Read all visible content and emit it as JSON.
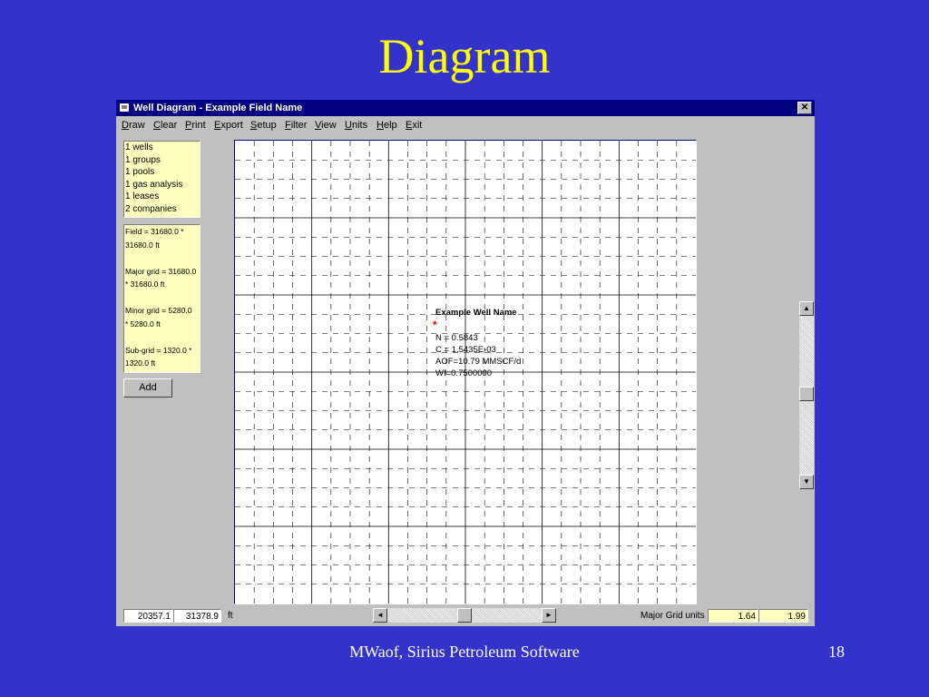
{
  "slide": {
    "title": "Diagram",
    "footer": "MWaof, Sirius Petroleum Software",
    "page_number": "18"
  },
  "window": {
    "title": "Well Diagram - Example Field Name",
    "close_label": "✕"
  },
  "menu": [
    "Draw",
    "Clear",
    "Print",
    "Export",
    "Setup",
    "Filter",
    "View",
    "Units",
    "Help",
    "Exit"
  ],
  "counts": [
    "1 wells",
    "1 groups",
    "1 pools",
    "1 gas analysis",
    "1 leases",
    "2 companies"
  ],
  "grid_info": [
    "Field = 31680.0 *",
    "31680.0 ft",
    "",
    "Major grid = 31680.0",
    "* 31680.0 ft",
    "",
    "Minor grid = 5280.0",
    "* 5280.0 ft",
    "",
    "Sub-grid = 1320.0 *",
    "1320.0 ft"
  ],
  "add_label": "Add",
  "well": {
    "name": "Example Well Name",
    "marker": "*",
    "n": "N = 0.5843",
    "c": "C = 1.5435E-03",
    "aof": "AOF=10.79 MMSCF/d",
    "wi": "WI=0.7500000"
  },
  "status": {
    "x_coord": "20357.1",
    "y_coord": "31378.9",
    "unit": "ft",
    "major_grid_label": "Major Grid units",
    "major_x": "1.64",
    "major_y": "1.99"
  },
  "scrollbars": {
    "up": "▲",
    "down": "▼",
    "left": "◄",
    "right": "►"
  },
  "colors": {
    "slide_background": "#3333CC",
    "title_color": "#FFFF00",
    "titlebar": "#000080",
    "info_panel": "#FFFFC0",
    "well_marker": "#FF0000"
  }
}
